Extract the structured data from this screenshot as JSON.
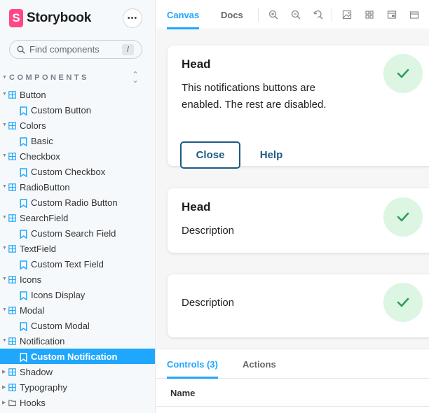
{
  "brand": {
    "name": "Storybook",
    "logo_letter": "S",
    "accent": "#ff4785"
  },
  "sidebar": {
    "menu_label": "•••",
    "search": {
      "placeholder": "Find components",
      "shortcut": "/"
    },
    "section_title": "COMPONENTS",
    "items": [
      {
        "type": "component",
        "label": "Button"
      },
      {
        "type": "story",
        "label": "Custom Button"
      },
      {
        "type": "component",
        "label": "Colors"
      },
      {
        "type": "story",
        "label": "Basic"
      },
      {
        "type": "component",
        "label": "Checkbox"
      },
      {
        "type": "story",
        "label": "Custom Checkbox"
      },
      {
        "type": "component",
        "label": "RadioButton"
      },
      {
        "type": "story",
        "label": "Custom Radio Button"
      },
      {
        "type": "component",
        "label": "SearchField"
      },
      {
        "type": "story",
        "label": "Custom Search Field"
      },
      {
        "type": "component",
        "label": "TextField"
      },
      {
        "type": "story",
        "label": "Custom Text Field"
      },
      {
        "type": "component",
        "label": "Icons"
      },
      {
        "type": "story",
        "label": "Icons Display"
      },
      {
        "type": "component",
        "label": "Modal"
      },
      {
        "type": "story",
        "label": "Custom Modal"
      },
      {
        "type": "component",
        "label": "Notification"
      },
      {
        "type": "story",
        "label": "Custom Notification",
        "selected": true
      },
      {
        "type": "component",
        "label": "Shadow"
      },
      {
        "type": "component",
        "label": "Typography"
      },
      {
        "type": "folder",
        "label": "Hooks"
      }
    ]
  },
  "toolbar": {
    "tabs": [
      {
        "label": "Canvas",
        "active": true
      },
      {
        "label": "Docs",
        "active": false
      }
    ],
    "icons": [
      "zoom-in-icon",
      "zoom-out-icon",
      "zoom-reset-icon",
      "background-icon",
      "grid-icon",
      "viewport-icon",
      "outline-icon"
    ]
  },
  "canvas": {
    "cards": [
      {
        "head": "Head",
        "body": "This notifications buttons are enabled. The rest are disabled.",
        "close_label": "Close",
        "help_label": "Help"
      },
      {
        "head": "Head",
        "body": "Description"
      },
      {
        "head": "",
        "body": "Description"
      }
    ]
  },
  "addons": {
    "tabs": [
      {
        "label": "Controls (3)",
        "active": true
      },
      {
        "label": "Actions",
        "active": false
      }
    ],
    "table_header": "Name"
  },
  "colors": {
    "accent": "#1ea7fd",
    "check_bg": "#dcf6e3",
    "check_fg": "#2f9e57",
    "button_dark": "#1d5a83"
  }
}
